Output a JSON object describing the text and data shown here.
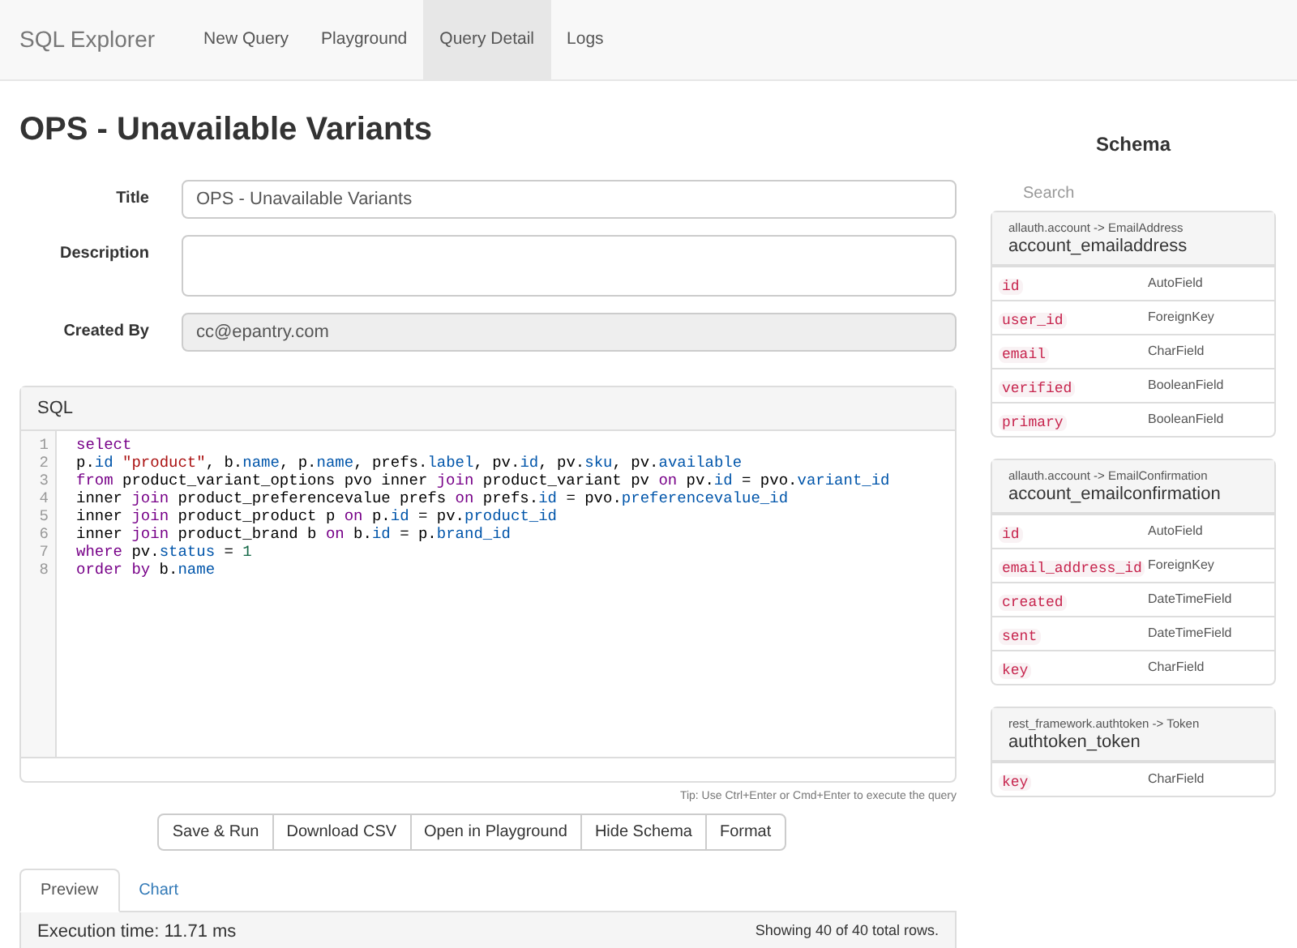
{
  "navbar": {
    "brand": "SQL Explorer",
    "items": [
      {
        "label": "New Query",
        "selected": false
      },
      {
        "label": "Playground",
        "selected": false
      },
      {
        "label": "Query Detail",
        "selected": true
      },
      {
        "label": "Logs",
        "selected": false
      }
    ]
  },
  "page_title": "OPS - Unavailable Variants",
  "form": {
    "fields": [
      {
        "label": "Title",
        "kind": "input",
        "value": "OPS - Unavailable Variants",
        "disabled": false
      },
      {
        "label": "Description",
        "kind": "textarea",
        "disabled": false
      },
      {
        "label": "Created By",
        "kind": "input",
        "value": "cc@epantry.com",
        "disabled": true
      }
    ]
  },
  "sql_panel": {
    "heading": "SQL",
    "lines": [
      {
        "number": "1",
        "tokens": [
          {
            "kind": "keyword",
            "text": "select"
          }
        ]
      },
      {
        "number": "2",
        "tokens": [
          {
            "kind": "plain",
            "text": "p."
          },
          {
            "kind": "property",
            "text": "id"
          },
          {
            "kind": "string",
            "text": " \"product\""
          },
          {
            "kind": "plain",
            "text": ", b."
          },
          {
            "kind": "property",
            "text": "name"
          },
          {
            "kind": "plain",
            "text": ", p."
          },
          {
            "kind": "property",
            "text": "name"
          },
          {
            "kind": "plain",
            "text": ", prefs."
          },
          {
            "kind": "property",
            "text": "label"
          },
          {
            "kind": "plain",
            "text": ", pv."
          },
          {
            "kind": "property",
            "text": "id"
          },
          {
            "kind": "plain",
            "text": ", pv."
          },
          {
            "kind": "property",
            "text": "sku"
          },
          {
            "kind": "plain",
            "text": ", pv."
          },
          {
            "kind": "property",
            "text": "available"
          }
        ]
      },
      {
        "number": "3",
        "tokens": [
          {
            "kind": "keyword",
            "text": "from"
          },
          {
            "kind": "plain",
            "text": " product_variant_options pvo inner "
          },
          {
            "kind": "keyword",
            "text": "join"
          },
          {
            "kind": "plain",
            "text": " product_variant pv "
          },
          {
            "kind": "keyword",
            "text": "on"
          },
          {
            "kind": "plain",
            "text": " pv."
          },
          {
            "kind": "property",
            "text": "id"
          },
          {
            "kind": "plain",
            "text": " = pvo."
          },
          {
            "kind": "property",
            "text": "variant_id"
          }
        ]
      },
      {
        "number": "4",
        "tokens": [
          {
            "kind": "plain",
            "text": "inner "
          },
          {
            "kind": "keyword",
            "text": "join"
          },
          {
            "kind": "plain",
            "text": " product_preferencevalue prefs "
          },
          {
            "kind": "keyword",
            "text": "on"
          },
          {
            "kind": "plain",
            "text": " prefs."
          },
          {
            "kind": "property",
            "text": "id"
          },
          {
            "kind": "plain",
            "text": " = pvo."
          },
          {
            "kind": "property",
            "text": "preferencevalue_id"
          }
        ]
      },
      {
        "number": "5",
        "tokens": [
          {
            "kind": "plain",
            "text": "inner "
          },
          {
            "kind": "keyword",
            "text": "join"
          },
          {
            "kind": "plain",
            "text": " product_product p "
          },
          {
            "kind": "keyword",
            "text": "on"
          },
          {
            "kind": "plain",
            "text": " p."
          },
          {
            "kind": "property",
            "text": "id"
          },
          {
            "kind": "plain",
            "text": " = pv."
          },
          {
            "kind": "property",
            "text": "product_id"
          }
        ]
      },
      {
        "number": "6",
        "tokens": [
          {
            "kind": "plain",
            "text": "inner "
          },
          {
            "kind": "keyword",
            "text": "join"
          },
          {
            "kind": "plain",
            "text": " product_brand b "
          },
          {
            "kind": "keyword",
            "text": "on"
          },
          {
            "kind": "plain",
            "text": " b."
          },
          {
            "kind": "property",
            "text": "id"
          },
          {
            "kind": "plain",
            "text": " = p."
          },
          {
            "kind": "property",
            "text": "brand_id"
          }
        ]
      },
      {
        "number": "7",
        "tokens": [
          {
            "kind": "keyword",
            "text": "where"
          },
          {
            "kind": "plain",
            "text": " pv."
          },
          {
            "kind": "property",
            "text": "status"
          },
          {
            "kind": "plain",
            "text": " = "
          },
          {
            "kind": "number",
            "text": "1"
          }
        ]
      },
      {
        "number": "8",
        "tokens": [
          {
            "kind": "keyword",
            "text": "order by"
          },
          {
            "kind": "plain",
            "text": " b."
          },
          {
            "kind": "property",
            "text": "name"
          }
        ]
      }
    ]
  },
  "tip": "Tip: Use Ctrl+Enter or Cmd+Enter to execute the query",
  "buttons": [
    "Save & Run",
    "Download CSV",
    "Open in Playground",
    "Hide Schema",
    "Format"
  ],
  "result_tabs": [
    {
      "label": "Preview",
      "selected": true
    },
    {
      "label": "Chart",
      "selected": false
    }
  ],
  "result_bar": {
    "execution_time": "Execution time: 11.71 ms",
    "row_count": "Showing 40 of 40 total rows."
  },
  "schema": {
    "heading": "Schema",
    "search": {
      "placeholder": "Search"
    },
    "tables": [
      {
        "model": "allauth.account -> EmailAddress",
        "name": "account_emailaddress",
        "columns": [
          {
            "name": "id",
            "type": "AutoField"
          },
          {
            "name": "user_id",
            "type": "ForeignKey"
          },
          {
            "name": "email",
            "type": "CharField"
          },
          {
            "name": "verified",
            "type": "BooleanField"
          },
          {
            "name": "primary",
            "type": "BooleanField"
          }
        ]
      },
      {
        "model": "allauth.account -> EmailConfirmation",
        "name": "account_emailconfirmation",
        "columns": [
          {
            "name": "id",
            "type": "AutoField"
          },
          {
            "name": "email_address_id",
            "type": "ForeignKey"
          },
          {
            "name": "created",
            "type": "DateTimeField"
          },
          {
            "name": "sent",
            "type": "DateTimeField"
          },
          {
            "name": "key",
            "type": "CharField"
          }
        ]
      },
      {
        "model": "rest_framework.authtoken -> Token",
        "name": "authtoken_token",
        "columns": [
          {
            "name": "key",
            "type": "CharField"
          }
        ]
      }
    ]
  }
}
